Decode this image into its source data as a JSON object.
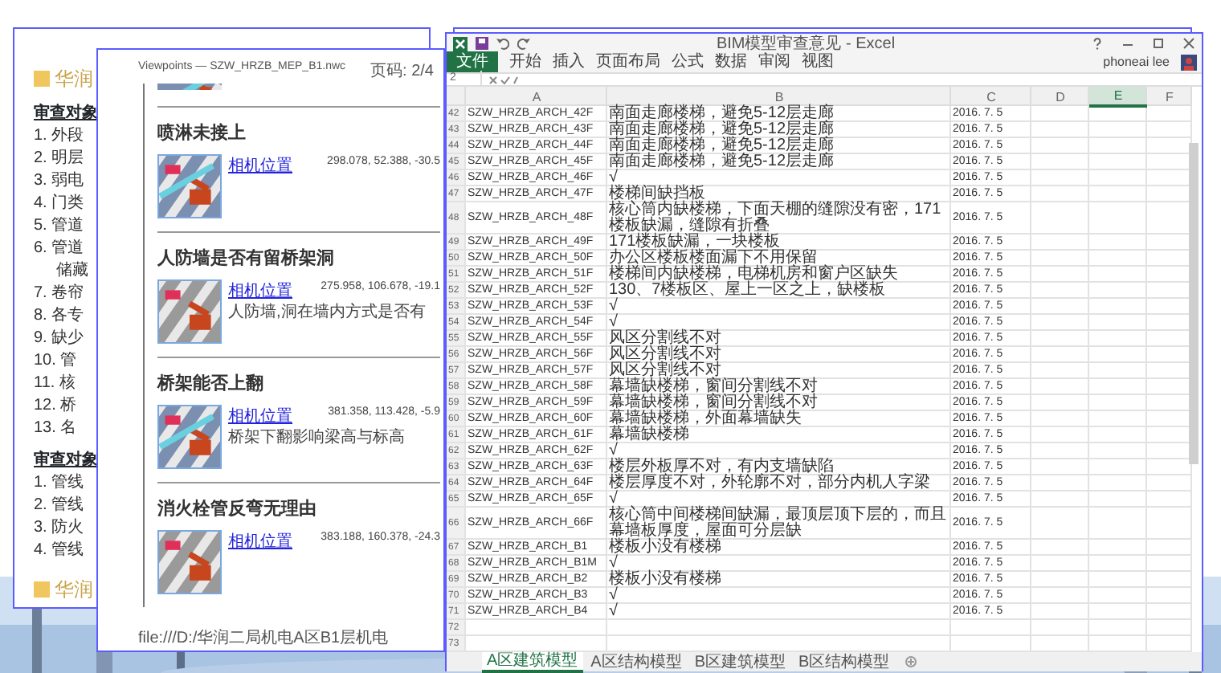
{
  "report_page": {
    "logo": "华润",
    "sections": [
      {
        "heading": "审查对象",
        "items": [
          {
            "kind": "item",
            "text": "1. 外段"
          },
          {
            "kind": "item",
            "text": "2. 明层"
          },
          {
            "kind": "item",
            "text": "3. 弱电"
          },
          {
            "kind": "item",
            "text": "4. 门类"
          },
          {
            "kind": "item",
            "text": "5. 管道"
          },
          {
            "kind": "item",
            "text": "6. 管道"
          },
          {
            "kind": "cont",
            "text": "储藏"
          },
          {
            "kind": "item",
            "text": "7. 卷帘"
          },
          {
            "kind": "item",
            "text": "8. 各专"
          },
          {
            "kind": "item",
            "text": "9. 缺少"
          },
          {
            "kind": "item",
            "text": "10. 管"
          },
          {
            "kind": "item",
            "text": "11. 核"
          },
          {
            "kind": "item",
            "text": "12. 桥"
          },
          {
            "kind": "item",
            "text": "13. 名"
          }
        ]
      },
      {
        "heading": "审查对象",
        "items": [
          {
            "kind": "item",
            "text": "1. 管线"
          },
          {
            "kind": "item",
            "text": "2. 管线"
          },
          {
            "kind": "item",
            "text": "3. 防火"
          },
          {
            "kind": "item",
            "text": "4. 管线"
          }
        ]
      }
    ],
    "footer_logo": "华润"
  },
  "viewpoints_page": {
    "header": "Viewpoints — SZW_HRZB_MEP_B1.nwc",
    "page": "页码: 2/4",
    "issues": [
      {
        "title": "喷淋未接上",
        "link": "相机位置",
        "coords": "298.078, 52.388, -30.5"
      },
      {
        "title": "人防墙是否有留桥架洞",
        "link": "相机位置",
        "coords": "275.958, 106.678, -19.1",
        "note": "人防墙,洞在墙内方式是否有"
      },
      {
        "title": "桥架能否上翻",
        "link": "相机位置",
        "coords": "381.358, 113.428, -5.9",
        "note": "桥架下翻影响梁高与标高"
      },
      {
        "title": "消火栓管反弯无理由",
        "link": "相机位置",
        "coords": "383.188, 160.378, -24.3"
      }
    ],
    "footer": "file:///D:/华润二局机电A区B1层机电"
  },
  "excel": {
    "title": "BIM模型审查意见 - Excel",
    "menu": [
      {
        "label": "文件",
        "kind": "file"
      },
      {
        "label": "开始",
        "kind": "tab"
      },
      {
        "label": "插入",
        "kind": "tab"
      },
      {
        "label": "页面布局",
        "kind": "tab"
      },
      {
        "label": "公式",
        "kind": "tab"
      },
      {
        "label": "数据",
        "kind": "tab"
      },
      {
        "label": "审阅",
        "kind": "tab"
      },
      {
        "label": "视图",
        "kind": "tab"
      }
    ],
    "user": "phoneai lee",
    "name_box": "2",
    "columns": [
      {
        "label": "A",
        "selected": false
      },
      {
        "label": "B",
        "selected": false
      },
      {
        "label": "C",
        "selected": false
      },
      {
        "label": "D",
        "selected": false
      },
      {
        "label": "E",
        "selected": true
      },
      {
        "label": "F",
        "selected": false
      }
    ],
    "rows": [
      {
        "number": "42",
        "cells": [
          "SZW_HRZB_ARCH_42F",
          "南面走廊楼梯，避免5-12层走廊",
          "2016. 7. 5"
        ]
      },
      {
        "number": "43",
        "cells": [
          "SZW_HRZB_ARCH_43F",
          "南面走廊楼梯，避免5-12层走廊",
          "2016. 7. 5"
        ]
      },
      {
        "number": "44",
        "cells": [
          "SZW_HRZB_ARCH_44F",
          "南面走廊楼梯，避免5-12层走廊",
          "2016. 7. 5"
        ]
      },
      {
        "number": "45",
        "cells": [
          "SZW_HRZB_ARCH_45F",
          "南面走廊楼梯，避免5-12层走廊",
          "2016. 7. 5"
        ]
      },
      {
        "number": "46",
        "cells": [
          "SZW_HRZB_ARCH_46F",
          "√",
          "2016. 7. 5"
        ]
      },
      {
        "number": "47",
        "cells": [
          "SZW_HRZB_ARCH_47F",
          "楼梯间缺挡板",
          "2016. 7. 5"
        ]
      },
      {
        "number": "48",
        "cells": [
          "SZW_HRZB_ARCH_48F",
          "核心筒内缺楼梯，下面天棚的缝隙没有密，171楼板缺漏，缝隙有折叠",
          "2016. 7. 5"
        ]
      },
      {
        "number": "49",
        "cells": [
          "SZW_HRZB_ARCH_49F",
          "171楼板缺漏，一块楼板",
          "2016. 7. 5"
        ]
      },
      {
        "number": "50",
        "cells": [
          "SZW_HRZB_ARCH_50F",
          "办公区楼板楼面漏下不用保留",
          "2016. 7. 5"
        ]
      },
      {
        "number": "51",
        "cells": [
          "SZW_HRZB_ARCH_51F",
          "楼梯间内缺楼梯，电梯机房和窗户区缺失",
          "2016. 7. 5"
        ]
      },
      {
        "number": "52",
        "cells": [
          "SZW_HRZB_ARCH_52F",
          "130、7楼板区、屋上一区之上，缺楼板",
          "2016. 7. 5"
        ]
      },
      {
        "number": "53",
        "cells": [
          "SZW_HRZB_ARCH_53F",
          "√",
          "2016. 7. 5"
        ]
      },
      {
        "number": "54",
        "cells": [
          "SZW_HRZB_ARCH_54F",
          "√",
          "2016. 7. 5"
        ]
      },
      {
        "number": "55",
        "cells": [
          "SZW_HRZB_ARCH_55F",
          "风区分割线不对",
          "2016. 7. 5"
        ]
      },
      {
        "number": "56",
        "cells": [
          "SZW_HRZB_ARCH_56F",
          "风区分割线不对",
          "2016. 7. 5"
        ]
      },
      {
        "number": "57",
        "cells": [
          "SZW_HRZB_ARCH_57F",
          "风区分割线不对",
          "2016. 7. 5"
        ]
      },
      {
        "number": "58",
        "cells": [
          "SZW_HRZB_ARCH_58F",
          "幕墙缺楼梯，窗间分割线不对",
          "2016. 7. 5"
        ]
      },
      {
        "number": "59",
        "cells": [
          "SZW_HRZB_ARCH_59F",
          "幕墙缺楼梯，窗间分割线不对",
          "2016. 7. 5"
        ]
      },
      {
        "number": "60",
        "cells": [
          "SZW_HRZB_ARCH_60F",
          "幕墙缺楼梯，外面幕墙缺失",
          "2016. 7. 5"
        ]
      },
      {
        "number": "61",
        "cells": [
          "SZW_HRZB_ARCH_61F",
          "幕墙缺楼梯",
          "2016. 7. 5"
        ]
      },
      {
        "number": "62",
        "cells": [
          "SZW_HRZB_ARCH_62F",
          "√",
          "2016. 7. 5"
        ]
      },
      {
        "number": "63",
        "cells": [
          "SZW_HRZB_ARCH_63F",
          "楼层外板厚不对，有内支墙缺陷",
          "2016. 7. 5"
        ]
      },
      {
        "number": "64",
        "cells": [
          "SZW_HRZB_ARCH_64F",
          "楼层厚度不对，外轮廓不对，部分内机人字梁",
          "2016. 7. 5"
        ]
      },
      {
        "number": "65",
        "cells": [
          "SZW_HRZB_ARCH_65F",
          "√",
          "2016. 7. 5"
        ]
      },
      {
        "number": "66",
        "cells": [
          "SZW_HRZB_ARCH_66F",
          "核心筒中间楼梯间缺漏，最顶层顶下层的，而且幕墙板厚度，屋面可分层缺",
          "2016. 7. 5"
        ]
      },
      {
        "number": "67",
        "cells": [
          "SZW_HRZB_ARCH_B1",
          "楼板小没有楼梯",
          "2016. 7. 5"
        ]
      },
      {
        "number": "68",
        "cells": [
          "SZW_HRZB_ARCH_B1M",
          "√",
          "2016. 7. 5"
        ]
      },
      {
        "number": "69",
        "cells": [
          "SZW_HRZB_ARCH_B2",
          "楼板小没有楼梯",
          "2016. 7. 5"
        ]
      },
      {
        "number": "70",
        "cells": [
          "SZW_HRZB_ARCH_B3",
          "√",
          "2016. 7. 5"
        ]
      },
      {
        "number": "71",
        "cells": [
          "SZW_HRZB_ARCH_B4",
          "√",
          "2016. 7. 5"
        ]
      },
      {
        "number": "72"
      },
      {
        "number": "73"
      }
    ],
    "sheets": [
      {
        "label": "A区建筑模型",
        "selected": true
      },
      {
        "label": "A区结构模型",
        "selected": false
      },
      {
        "label": "B区建筑模型",
        "selected": false
      },
      {
        "label": "B区结构模型",
        "selected": false
      }
    ]
  }
}
